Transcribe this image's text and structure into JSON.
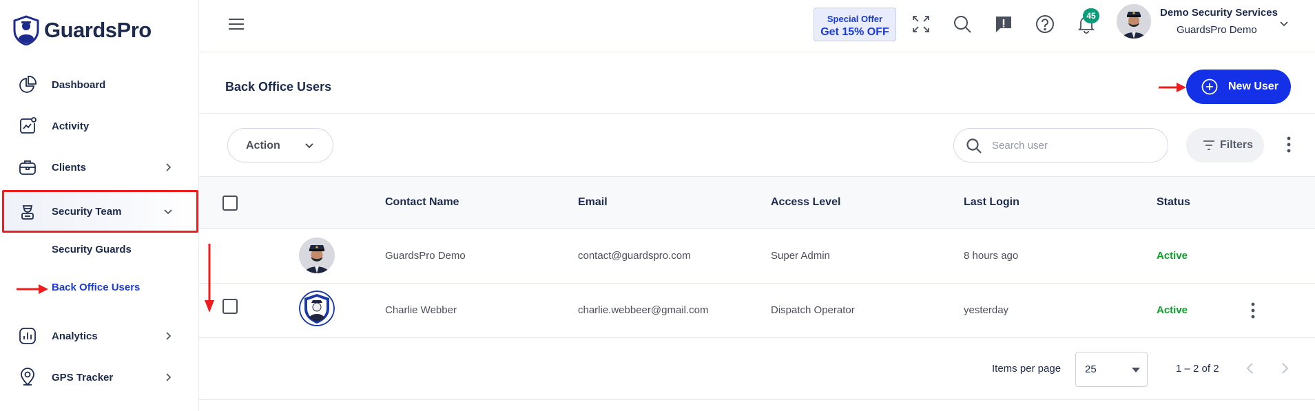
{
  "brand": {
    "name": "GuardsPro",
    "accent": "#1431e8"
  },
  "sidebar": {
    "items": [
      {
        "label": "Dashboard",
        "icon": "pie-chart-icon"
      },
      {
        "label": "Activity",
        "icon": "activity-icon"
      },
      {
        "label": "Clients",
        "icon": "briefcase-icon"
      },
      {
        "label": "Security Team",
        "icon": "guard-icon"
      },
      {
        "label": "Analytics",
        "icon": "analytics-icon"
      },
      {
        "label": "GPS Tracker",
        "icon": "location-pin-icon"
      }
    ],
    "subitems": [
      {
        "label": "Security Guards"
      },
      {
        "label": "Back Office Users"
      }
    ]
  },
  "topbar": {
    "offer_line1": "Special Offer",
    "offer_line2": "Get 15% OFF",
    "notification_count": "45",
    "user_name": "Demo Security Services",
    "user_org": "GuardsPro Demo"
  },
  "page": {
    "title": "Back Office Users",
    "new_user_label": "New User"
  },
  "toolbar": {
    "action_label": "Action",
    "search_placeholder": "Search user",
    "filters_label": "Filters"
  },
  "table": {
    "columns": [
      "Contact Name",
      "Email",
      "Access Level",
      "Last Login",
      "Status"
    ],
    "rows": [
      {
        "name": "GuardsPro Demo",
        "email": "contact@guardspro.com",
        "access": "Super Admin",
        "last_login": "8 hours ago",
        "status": "Active"
      },
      {
        "name": "Charlie Webber",
        "email": "charlie.webbeer@gmail.com",
        "access": "Dispatch Operator",
        "last_login": "yesterday",
        "status": "Active"
      }
    ]
  },
  "pagination": {
    "items_per_page_label": "Items per page",
    "items_per_page": "25",
    "range": "1 – 2 of 2"
  }
}
